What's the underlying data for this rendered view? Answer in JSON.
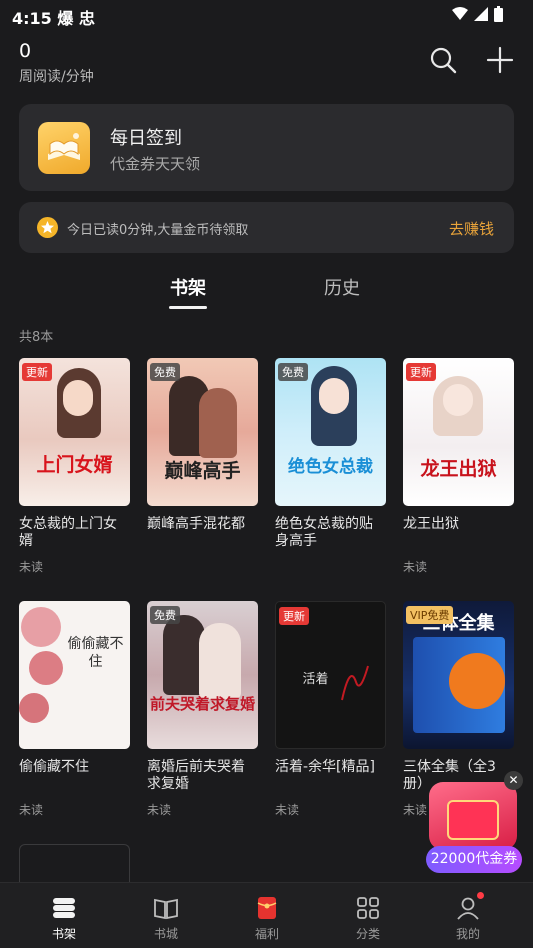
{
  "status_bar": {
    "time": "4:15 爆 忠"
  },
  "header": {
    "count": "0",
    "caption": "周阅读/分钟",
    "search_icon": "search-icon",
    "add_icon": "plus-icon"
  },
  "checkin": {
    "title": "每日签到",
    "subtitle": "代金券天天领",
    "icon": "book-icon"
  },
  "coin_banner": {
    "text": "今日已读0分钟,大量金币待领取",
    "link": "去赚钱",
    "link_color": "#e8a33a"
  },
  "tabs": [
    {
      "label": "书架",
      "active": true
    },
    {
      "label": "历史",
      "active": false
    }
  ],
  "book_count": "共8本",
  "books": [
    {
      "title": "女总裁的上门女婿",
      "status": "未读",
      "badge": "更新",
      "cover_text": "上门女婿"
    },
    {
      "title": "巅峰高手混花都",
      "status": "",
      "badge": "免费",
      "cover_text": "巅峰高手"
    },
    {
      "title": "绝色女总裁的贴身高手",
      "status": "",
      "badge": "免费",
      "cover_text": "绝色女总裁"
    },
    {
      "title": "龙王出狱",
      "status": "未读",
      "badge": "更新",
      "cover_text": "龙王出狱"
    },
    {
      "title": "偷偷藏不住",
      "status": "未读",
      "badge": "",
      "cover_text": "偷偷藏不住"
    },
    {
      "title": "离婚后前夫哭着求复婚",
      "status": "未读",
      "badge": "免费",
      "cover_text": "前夫哭着求复婚"
    },
    {
      "title": "活着-余华[精品]",
      "status": "未读",
      "badge": "更新",
      "cover_text": "活着"
    },
    {
      "title": "三体全集（全3册）",
      "status": "未读",
      "badge": "VIP免费",
      "cover_text": "三体全集"
    }
  ],
  "promo": {
    "label": "22000代金券",
    "close": "✕"
  },
  "nav": [
    {
      "label": "书架",
      "icon": "bookshelf-icon",
      "active": true
    },
    {
      "label": "书城",
      "icon": "open-book-icon",
      "active": false
    },
    {
      "label": "福利",
      "icon": "red-packet-icon",
      "active": false
    },
    {
      "label": "分类",
      "icon": "grid-icon",
      "active": false
    },
    {
      "label": "我的",
      "icon": "user-icon",
      "active": false
    }
  ],
  "colors": {
    "accent": "#e8a33a",
    "update_badge": "#e53935",
    "background": "#1b1b1d"
  }
}
